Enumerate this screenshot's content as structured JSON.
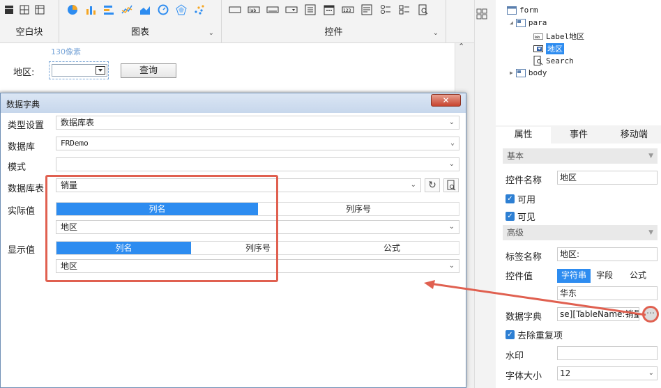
{
  "ribbon": {
    "blank_block_label": "空白块",
    "chart_label": "图表",
    "controls_label": "控件"
  },
  "canvas": {
    "size_hint": "130像素",
    "region_label": "地区:",
    "query_button": "查询"
  },
  "tree": {
    "form": "form",
    "para": "para",
    "label_item": "Label地区",
    "combo_item": "地区",
    "search_item": "Search",
    "body": "body"
  },
  "panel": {
    "tabs": [
      "属性",
      "事件",
      "移动端"
    ],
    "basic_section": "基本",
    "control_name_label": "控件名称",
    "control_name_value": "地区",
    "enabled_label": "可用",
    "visible_label": "可见",
    "advanced_section": "高级",
    "tag_name_label": "标签名称",
    "tag_name_value": "地区:",
    "control_value_label": "控件值",
    "value_modes": [
      "字符串",
      "字段",
      "公式"
    ],
    "control_value": "华东",
    "data_dict_label": "数据字典",
    "data_dict_value": "se][TableName:销量]",
    "dedupe_label": "去除重复项",
    "watermark_label": "水印",
    "watermark_value": "",
    "font_size_label": "字体大小",
    "font_size_value": "12"
  },
  "dialog": {
    "title": "数据字典",
    "type_label": "类型设置",
    "type_value": "数据库表",
    "db_label": "数据库",
    "db_value": "FRDemo",
    "schema_label": "模式",
    "schema_value": "",
    "table_label": "数据库表",
    "table_value": "销量",
    "actual_label": "实际值",
    "actual_modes": [
      "列名",
      "列序号"
    ],
    "actual_value": "地区",
    "display_label": "显示值",
    "display_modes": [
      "列名",
      "列序号",
      "公式"
    ],
    "display_value": "地区"
  },
  "colors": {
    "accent": "#2d8cf0",
    "highlight": "#e06050",
    "check": "#2d7fd3"
  }
}
